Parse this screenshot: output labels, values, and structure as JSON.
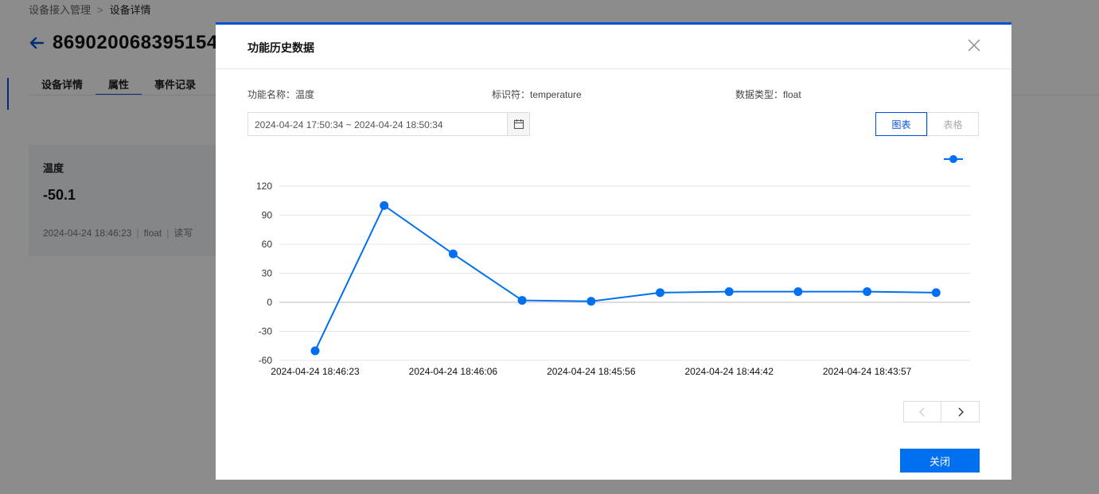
{
  "breadcrumb": {
    "parent": "设备接入管理",
    "separator": ">",
    "current": "设备详情"
  },
  "device": {
    "id": "869020068395154"
  },
  "tabs": [
    {
      "label": "设备详情"
    },
    {
      "label": "属性"
    },
    {
      "label": "事件记录"
    }
  ],
  "property_card": {
    "name": "温度",
    "value": "-50.1",
    "time": "2024-04-24 18:46:23",
    "type": "float",
    "access": "读写"
  },
  "modal": {
    "title": "功能历史数据",
    "function_name": "功能名称：温度",
    "identifier": "标识符：temperature",
    "data_type": "数据类型：float",
    "date_range": "2024-04-24 17:50:34 ~ 2024-04-24 18:50:34",
    "view_chart": "图表",
    "view_table": "表格",
    "close_button": "关闭"
  },
  "colors": {
    "accent": "#0052d9",
    "series": "#0070f0",
    "button": "#0070f0"
  },
  "icons": [
    "back-arrow-icon",
    "close-icon",
    "calendar-icon",
    "chevron-left-icon",
    "chevron-right-icon",
    "legend-marker-icon"
  ],
  "chart_data": {
    "type": "line",
    "title": "",
    "xlabel": "",
    "ylabel": "",
    "ylim": [
      -60,
      120
    ],
    "yticks": [
      120,
      90,
      60,
      30,
      0,
      -30,
      -60
    ],
    "x_tick_labels": [
      "2024-04-24 18:46:23",
      "2024-04-24 18:46:06",
      "2024-04-24 18:45:56",
      "2024-04-24 18:44:42",
      "2024-04-24 18:43:57"
    ],
    "legend": "top-right",
    "grid": true,
    "series": [
      {
        "values": [
          -50.1,
          100,
          50,
          2,
          1,
          10,
          11,
          11,
          11,
          10
        ]
      }
    ]
  }
}
